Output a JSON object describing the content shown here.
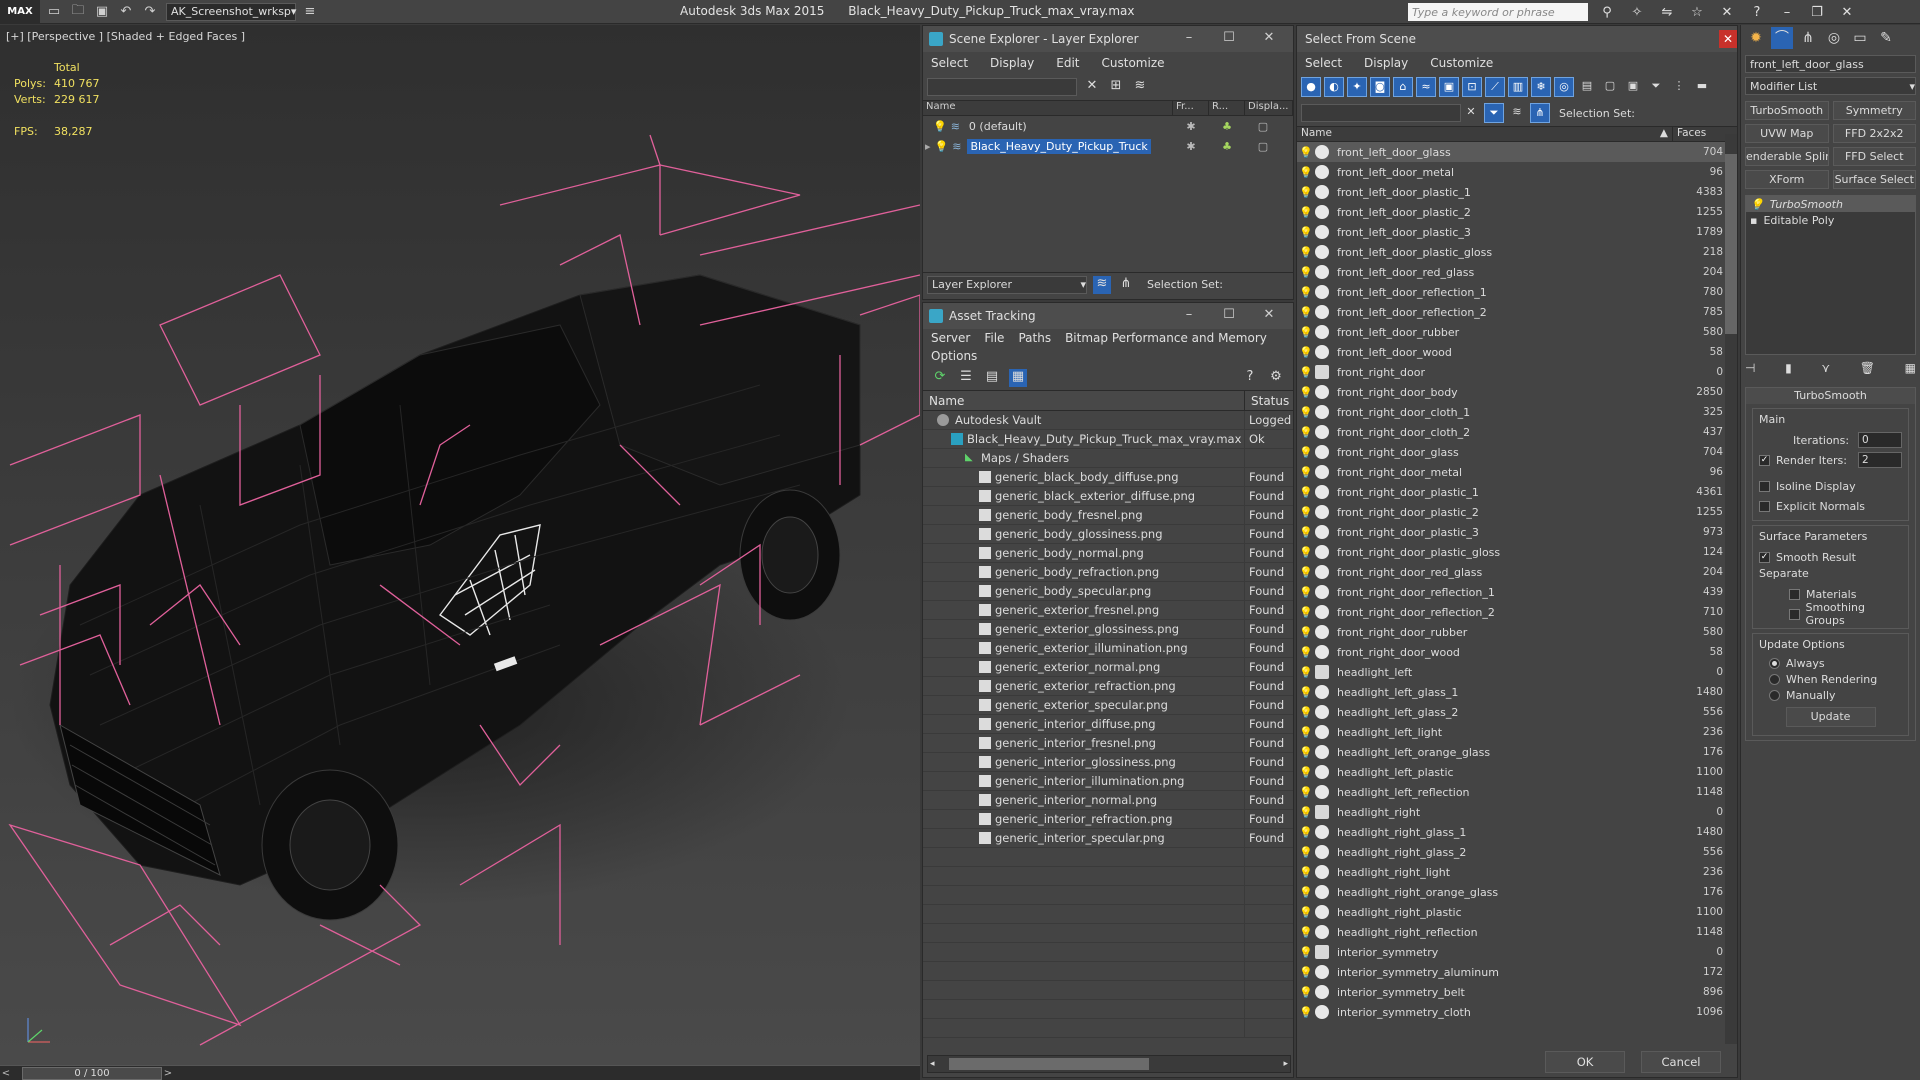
{
  "titlebar": {
    "logo": "MAX",
    "workspace": "AK_Screenshot_wrksp",
    "app_name": "Autodesk 3ds Max  2015",
    "file_name": "Black_Heavy_Duty_Pickup_Truck_max_vray.max",
    "search_placeholder": "Type a keyword or phrase"
  },
  "viewport": {
    "label": "[+] [Perspective ] [Shaded + Edged Faces ]",
    "stats_header": "Total",
    "polys_label": "Polys:",
    "polys_value": "410 767",
    "verts_label": "Verts:",
    "verts_value": "229 617",
    "fps_label": "FPS:",
    "fps_value": "38,287"
  },
  "timeslider": {
    "value": "0 / 100"
  },
  "scene_explorer": {
    "title": "Scene Explorer - Layer Explorer",
    "menu": [
      "Select",
      "Display",
      "Edit",
      "Customize"
    ],
    "columns": [
      "Name",
      "Fr...",
      "R...",
      "Displa..."
    ],
    "rows": [
      {
        "name": "0 (default)",
        "selected": false
      },
      {
        "name": "Black_Heavy_Duty_Pickup_Truck",
        "selected": true
      }
    ],
    "layer_dropdown": "Layer Explorer",
    "selection_set_label": "Selection Set:"
  },
  "asset_tracking": {
    "title": "Asset Tracking",
    "menu": [
      "Server",
      "File",
      "Paths",
      "Bitmap Performance and Memory"
    ],
    "menu2": [
      "Options"
    ],
    "columns": [
      "Name",
      "Status"
    ],
    "rows": [
      {
        "name": "Autodesk Vault",
        "status": "Logged",
        "indent": 1,
        "kind": "vault"
      },
      {
        "name": "Black_Heavy_Duty_Pickup_Truck_max_vray.max",
        "status": "Ok",
        "indent": 2,
        "kind": "max"
      },
      {
        "name": "Maps / Shaders",
        "status": "",
        "indent": 3,
        "kind": "folder"
      },
      {
        "name": "generic_black_body_diffuse.png",
        "status": "Found",
        "indent": 4,
        "kind": "file"
      },
      {
        "name": "generic_black_exterior_diffuse.png",
        "status": "Found",
        "indent": 4,
        "kind": "file"
      },
      {
        "name": "generic_body_fresnel.png",
        "status": "Found",
        "indent": 4,
        "kind": "file"
      },
      {
        "name": "generic_body_glossiness.png",
        "status": "Found",
        "indent": 4,
        "kind": "file"
      },
      {
        "name": "generic_body_normal.png",
        "status": "Found",
        "indent": 4,
        "kind": "file"
      },
      {
        "name": "generic_body_refraction.png",
        "status": "Found",
        "indent": 4,
        "kind": "file"
      },
      {
        "name": "generic_body_specular.png",
        "status": "Found",
        "indent": 4,
        "kind": "file"
      },
      {
        "name": "generic_exterior_fresnel.png",
        "status": "Found",
        "indent": 4,
        "kind": "file"
      },
      {
        "name": "generic_exterior_glossiness.png",
        "status": "Found",
        "indent": 4,
        "kind": "file"
      },
      {
        "name": "generic_exterior_illumination.png",
        "status": "Found",
        "indent": 4,
        "kind": "file"
      },
      {
        "name": "generic_exterior_normal.png",
        "status": "Found",
        "indent": 4,
        "kind": "file"
      },
      {
        "name": "generic_exterior_refraction.png",
        "status": "Found",
        "indent": 4,
        "kind": "file"
      },
      {
        "name": "generic_exterior_specular.png",
        "status": "Found",
        "indent": 4,
        "kind": "file"
      },
      {
        "name": "generic_interior_diffuse.png",
        "status": "Found",
        "indent": 4,
        "kind": "file"
      },
      {
        "name": "generic_interior_fresnel.png",
        "status": "Found",
        "indent": 4,
        "kind": "file"
      },
      {
        "name": "generic_interior_glossiness.png",
        "status": "Found",
        "indent": 4,
        "kind": "file"
      },
      {
        "name": "generic_interior_illumination.png",
        "status": "Found",
        "indent": 4,
        "kind": "file"
      },
      {
        "name": "generic_interior_normal.png",
        "status": "Found",
        "indent": 4,
        "kind": "file"
      },
      {
        "name": "generic_interior_refraction.png",
        "status": "Found",
        "indent": 4,
        "kind": "file"
      },
      {
        "name": "generic_interior_specular.png",
        "status": "Found",
        "indent": 4,
        "kind": "file"
      }
    ]
  },
  "select_from_scene": {
    "title": "Select From Scene",
    "menu": [
      "Select",
      "Display",
      "Customize"
    ],
    "selection_set_label": "Selection Set:",
    "columns": [
      "Name",
      "Faces"
    ],
    "rows": [
      {
        "name": "front_left_door_glass",
        "faces": "704",
        "selected": true
      },
      {
        "name": "front_left_door_metal",
        "faces": "96"
      },
      {
        "name": "front_left_door_plastic_1",
        "faces": "4383"
      },
      {
        "name": "front_left_door_plastic_2",
        "faces": "1255"
      },
      {
        "name": "front_left_door_plastic_3",
        "faces": "1789"
      },
      {
        "name": "front_left_door_plastic_gloss",
        "faces": "218"
      },
      {
        "name": "front_left_door_red_glass",
        "faces": "204"
      },
      {
        "name": "front_left_door_reflection_1",
        "faces": "780"
      },
      {
        "name": "front_left_door_reflection_2",
        "faces": "785"
      },
      {
        "name": "front_left_door_rubber",
        "faces": "580"
      },
      {
        "name": "front_left_door_wood",
        "faces": "58"
      },
      {
        "name": "front_right_door",
        "faces": "0",
        "group": true
      },
      {
        "name": "front_right_door_body",
        "faces": "2850"
      },
      {
        "name": "front_right_door_cloth_1",
        "faces": "325"
      },
      {
        "name": "front_right_door_cloth_2",
        "faces": "437"
      },
      {
        "name": "front_right_door_glass",
        "faces": "704"
      },
      {
        "name": "front_right_door_metal",
        "faces": "96"
      },
      {
        "name": "front_right_door_plastic_1",
        "faces": "4361"
      },
      {
        "name": "front_right_door_plastic_2",
        "faces": "1255"
      },
      {
        "name": "front_right_door_plastic_3",
        "faces": "973"
      },
      {
        "name": "front_right_door_plastic_gloss",
        "faces": "124"
      },
      {
        "name": "front_right_door_red_glass",
        "faces": "204"
      },
      {
        "name": "front_right_door_reflection_1",
        "faces": "439"
      },
      {
        "name": "front_right_door_reflection_2",
        "faces": "710"
      },
      {
        "name": "front_right_door_rubber",
        "faces": "580"
      },
      {
        "name": "front_right_door_wood",
        "faces": "58"
      },
      {
        "name": "headlight_left",
        "faces": "0",
        "group": true
      },
      {
        "name": "headlight_left_glass_1",
        "faces": "1480"
      },
      {
        "name": "headlight_left_glass_2",
        "faces": "556"
      },
      {
        "name": "headlight_left_light",
        "faces": "236"
      },
      {
        "name": "headlight_left_orange_glass",
        "faces": "176"
      },
      {
        "name": "headlight_left_plastic",
        "faces": "1100"
      },
      {
        "name": "headlight_left_reflection",
        "faces": "1148"
      },
      {
        "name": "headlight_right",
        "faces": "0",
        "group": true
      },
      {
        "name": "headlight_right_glass_1",
        "faces": "1480"
      },
      {
        "name": "headlight_right_glass_2",
        "faces": "556"
      },
      {
        "name": "headlight_right_light",
        "faces": "236"
      },
      {
        "name": "headlight_right_orange_glass",
        "faces": "176"
      },
      {
        "name": "headlight_right_plastic",
        "faces": "1100"
      },
      {
        "name": "headlight_right_reflection",
        "faces": "1148"
      },
      {
        "name": "interior_symmetry",
        "faces": "0",
        "group": true
      },
      {
        "name": "interior_symmetry_aluminum",
        "faces": "172"
      },
      {
        "name": "interior_symmetry_belt",
        "faces": "896"
      },
      {
        "name": "interior_symmetry_cloth",
        "faces": "1096"
      }
    ],
    "ok_label": "OK",
    "cancel_label": "Cancel"
  },
  "command_panel": {
    "object_name": "front_left_door_glass",
    "modifier_list": "Modifier List",
    "quick_buttons": [
      "TurboSmooth",
      "Symmetry",
      "UVW Map",
      "FFD 2x2x2",
      "enderable Splir",
      "FFD Select",
      "XForm",
      "Surface Select"
    ],
    "stack": [
      "TurboSmooth",
      "Editable Poly"
    ],
    "turbosmooth": {
      "header": "TurboSmooth",
      "main_label": "Main",
      "iterations_label": "Iterations:",
      "iterations_value": "0",
      "render_iters_label": "Render Iters:",
      "render_iters_value": "2",
      "isoline_label": "Isoline Display",
      "explicit_normals_label": "Explicit Normals",
      "surface_params_label": "Surface Parameters",
      "smooth_result_label": "Smooth Result",
      "separate_label": "Separate",
      "materials_label": "Materials",
      "smoothing_groups_label": "Smoothing Groups",
      "update_options_label": "Update Options",
      "always_label": "Always",
      "when_rendering_label": "When Rendering",
      "manually_label": "Manually",
      "update_label": "Update"
    }
  },
  "colors": {
    "accent_blue": "#2a64b3",
    "wireframe_pink": "#e0609a",
    "stats_yellow": "#f0e060",
    "close_red": "#c8312b"
  }
}
